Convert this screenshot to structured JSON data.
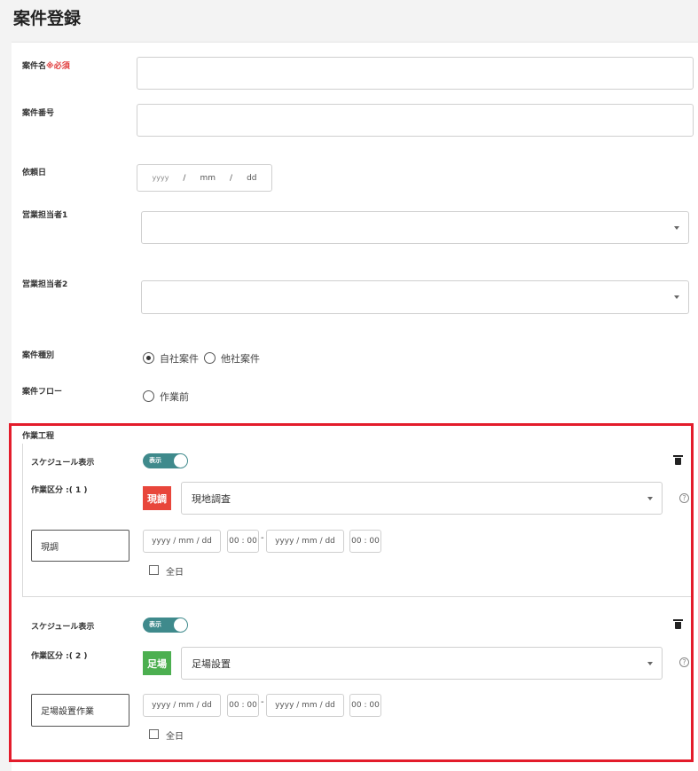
{
  "page": {
    "title": "案件登録"
  },
  "form": {
    "project_name": {
      "label": "案件名",
      "required": "※必須",
      "value": ""
    },
    "project_number": {
      "label": "案件番号",
      "value": ""
    },
    "request_date": {
      "label": "依頼日",
      "y": "yyyy",
      "sep": "/",
      "m": "mm",
      "d": "dd"
    },
    "sales1": {
      "label": "営業担当者1",
      "value": ""
    },
    "sales2": {
      "label": "営業担当者2",
      "value": ""
    },
    "project_type": {
      "label": "案件種別",
      "options": [
        "自社案件",
        "他社案件"
      ],
      "selected": "自社案件"
    },
    "project_flow": {
      "label": "案件フロー",
      "options": [
        "作業前"
      ]
    }
  },
  "work_process": {
    "label": "作業工程",
    "items": [
      {
        "schedule_label": "スケジュール表示",
        "toggle_text": "表示",
        "division_label": "作業区分 :( 1 )",
        "badge": "現調",
        "badge_color": "#e8463b",
        "select_value": "現地調査",
        "name_value": "現調",
        "date_start": "yyyy / mm / dd",
        "time_start": "00 : 00",
        "range_sep": "-",
        "date_end": "yyyy / mm / dd",
        "time_end": "00 : 00",
        "all_day": "全日"
      },
      {
        "schedule_label": "スケジュール表示",
        "toggle_text": "表示",
        "division_label": "作業区分 :( 2 )",
        "badge": "足場",
        "badge_color": "#4caf50",
        "select_value": "足場設置",
        "name_value": "足場設置作業",
        "date_start": "yyyy / mm / dd",
        "time_start": "00 : 00",
        "range_sep": "-",
        "date_end": "yyyy / mm / dd",
        "time_end": "00 : 00",
        "all_day": "全日"
      }
    ]
  },
  "icons": {
    "trash": "trash-icon",
    "help": "question-circle-icon",
    "caret": "chevron-down-icon"
  }
}
